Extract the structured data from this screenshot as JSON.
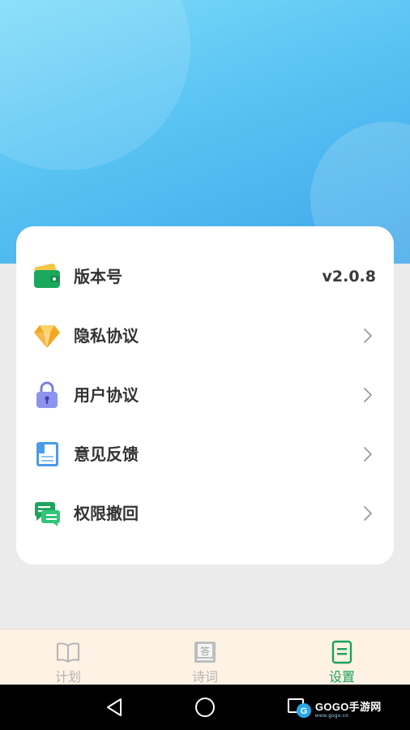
{
  "settings": {
    "items": [
      {
        "label": "版本号",
        "value": "v2.0.8",
        "icon": "wallet-icon"
      },
      {
        "label": "隐私协议",
        "icon": "diamond-icon"
      },
      {
        "label": "用户协议",
        "icon": "lock-icon"
      },
      {
        "label": "意见反馈",
        "icon": "book-icon"
      },
      {
        "label": "权限撤回",
        "icon": "chat-icon"
      }
    ]
  },
  "tabs": [
    {
      "label": "计划",
      "icon": "open-book-icon",
      "active": false
    },
    {
      "label": "诗词",
      "icon": "poem-book-icon",
      "active": false
    },
    {
      "label": "设置",
      "icon": "document-icon",
      "active": true
    }
  ],
  "colors": {
    "accent": "#1aa260",
    "inactive_tab": "#b5b5b5",
    "tab_background": "#fdf2e4",
    "header_gradient": [
      "#7fdcf9",
      "#3fa6e8"
    ]
  },
  "system_nav": {
    "icons": [
      "back-icon",
      "home-icon",
      "recents-icon"
    ]
  },
  "watermark": {
    "text": "GOGO手游网",
    "sub": "www.gogo.cn"
  }
}
